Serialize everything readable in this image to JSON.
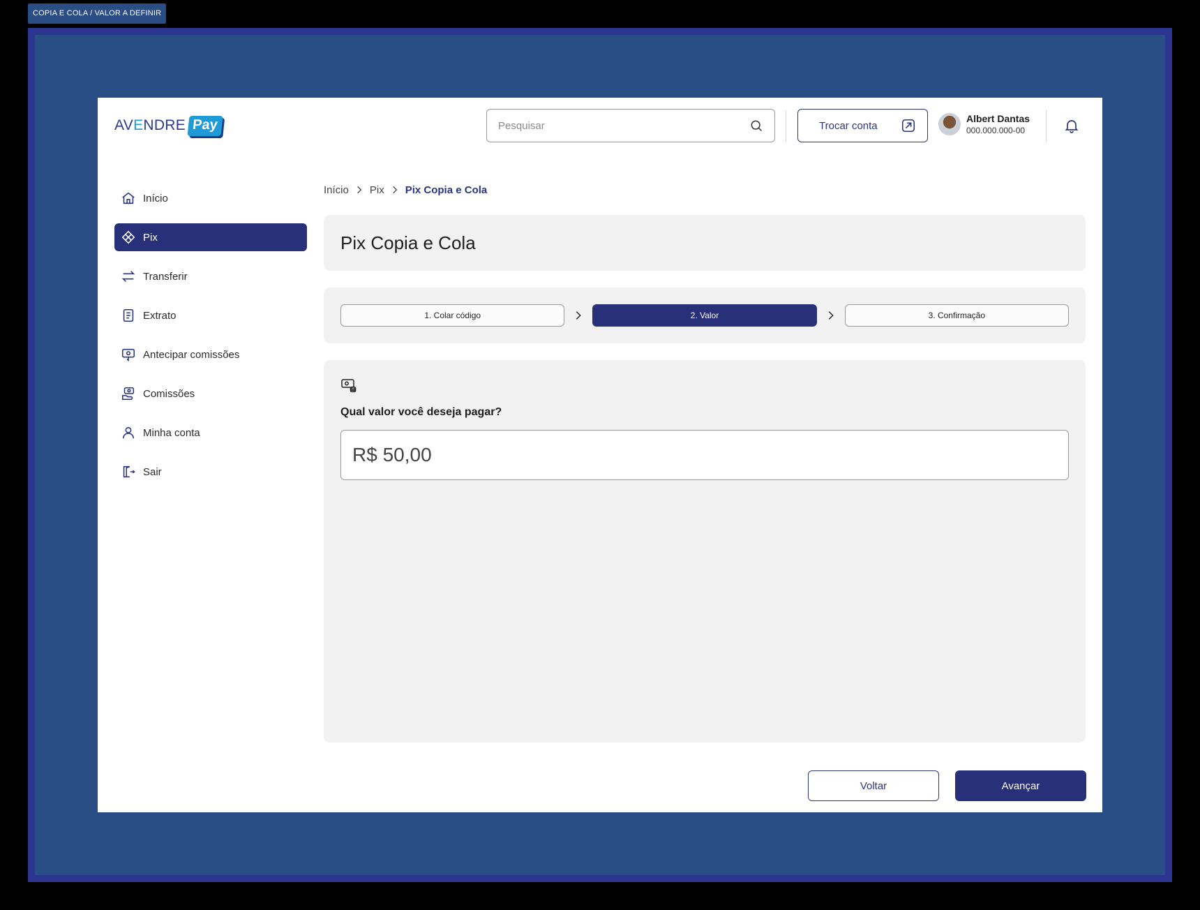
{
  "frame": {
    "tag": "COPIA E COLA / VALOR A DEFINIR"
  },
  "header": {
    "logo": {
      "word_a": "AV",
      "word_e": "E",
      "word_b": "NDRE",
      "badge": "Pay"
    },
    "search": {
      "placeholder": "Pesquisar",
      "value": ""
    },
    "switch_account_label": "Trocar conta",
    "user": {
      "name": "Albert Dantas",
      "document": "000.000.000-00"
    }
  },
  "sidebar": {
    "items": [
      {
        "label": "Início",
        "icon": "home-icon",
        "active": false
      },
      {
        "label": "Pix",
        "icon": "pix-icon",
        "active": true
      },
      {
        "label": "Transferir",
        "icon": "transfer-icon",
        "active": false
      },
      {
        "label": "Extrato",
        "icon": "statement-icon",
        "active": false
      },
      {
        "label": "Antecipar comissões",
        "icon": "advance-commission-icon",
        "active": false
      },
      {
        "label": "Comissões",
        "icon": "commission-icon",
        "active": false
      },
      {
        "label": "Minha conta",
        "icon": "user-icon",
        "active": false
      },
      {
        "label": "Sair",
        "icon": "logout-icon",
        "active": false
      }
    ]
  },
  "breadcrumb": [
    "Início",
    "Pix",
    "Pix Copia e Cola"
  ],
  "page_title": "Pix Copia e Cola",
  "steps": [
    {
      "label": "1. Colar código",
      "active": false
    },
    {
      "label": "2. Valor",
      "active": true
    },
    {
      "label": "3. Confirmação",
      "active": false
    }
  ],
  "form": {
    "question": "Qual valor você deseja pagar?",
    "amount_value": "R$ 50,00"
  },
  "actions": {
    "back_label": "Voltar",
    "next_label": "Avançar"
  },
  "colors": {
    "primary": "#28307a",
    "accent": "#1e9ad6",
    "card": "#f2f2f2",
    "frame": "#294e85"
  }
}
